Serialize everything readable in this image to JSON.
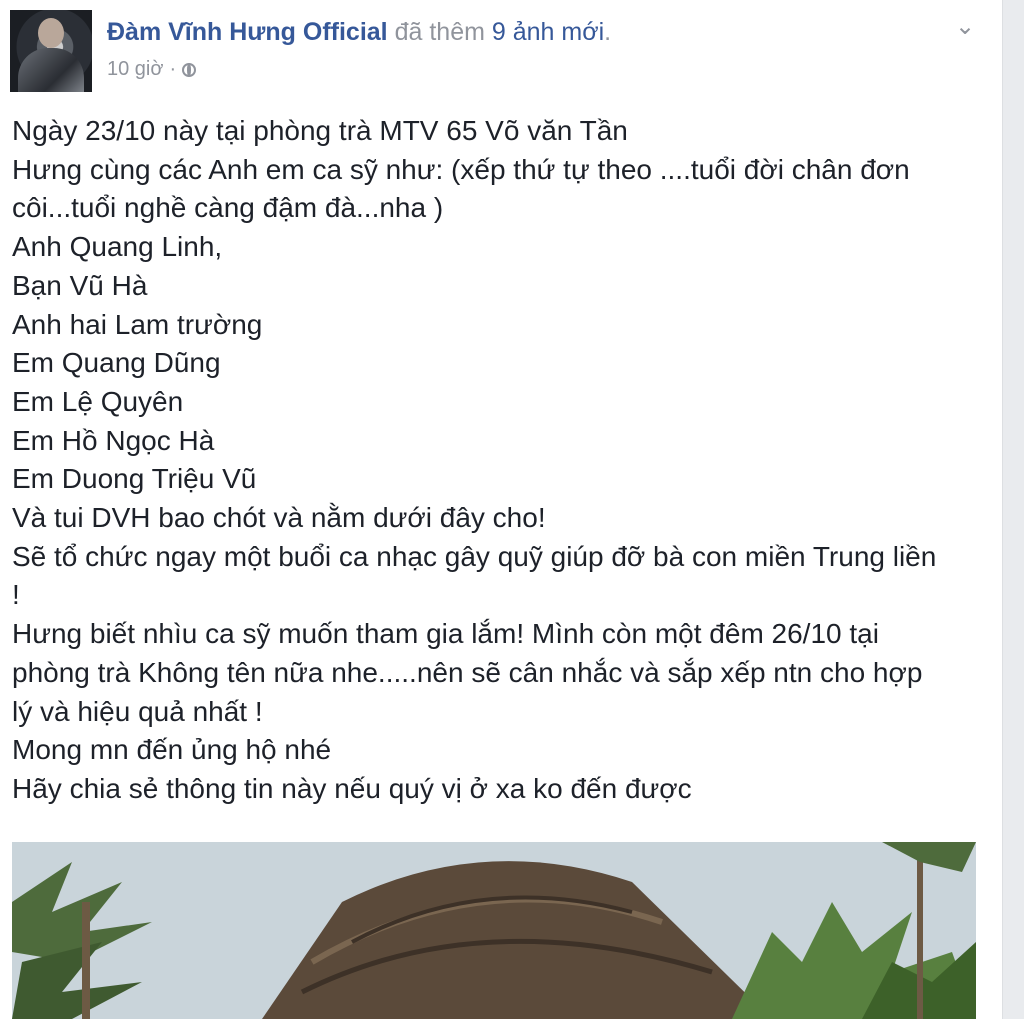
{
  "post": {
    "author": "Đàm Vĩnh Hưng Official",
    "action_before": " đã thêm ",
    "photo_count": "9 ảnh mới",
    "action_after": ".",
    "time": "10 giờ",
    "separator": "·",
    "privacy_icon": "globe-icon",
    "menu_icon": "chevron-down-icon",
    "lines": [
      "Ngày 23/10 này tại phòng trà MTV 65 Võ văn Tần",
      "Hưng cùng các Anh em ca sỹ như: (xếp thứ tự theo ....tuổi đời chân đơn",
      "côi...tuổi nghề càng đậm đà...nha )",
      "Anh Quang Linh,",
      "Bạn Vũ Hà",
      "Anh hai Lam trường",
      "Em Quang Dũng",
      "Em Lệ Quyên",
      "Em Hồ Ngọc Hà",
      "Em Duong Triệu Vũ",
      "Và tui DVH bao chót và nằm dưới đây cho!",
      "Sẽ tổ chức ngay một buổi ca nhạc gây quỹ giúp đỡ bà con miền Trung liền",
      "!",
      "Hưng biết nhìu ca sỹ muốn tham gia lắm! Mình còn một đêm 26/10 tại",
      "phòng trà Không tên nữa nhe.....nên sẽ cân nhắc và sắp xếp ntn cho hợp",
      "lý và hiệu quả nhất !",
      "Mong mn đến ủng hộ nhé",
      "Hãy chia sẻ thông tin này nếu quý vị ở xa ko đến được"
    ]
  },
  "colors": {
    "link": "#365899",
    "meta": "#90949c",
    "text": "#1d2129"
  }
}
